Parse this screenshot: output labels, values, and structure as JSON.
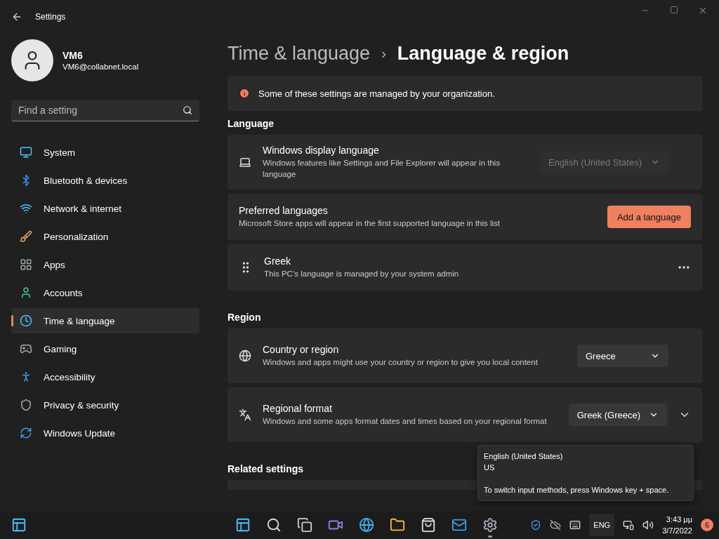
{
  "window": {
    "title": "Settings"
  },
  "user": {
    "name": "VM6",
    "email": "VM6@collabnet.local"
  },
  "search": {
    "placeholder": "Find a setting"
  },
  "nav": [
    {
      "label": "System",
      "selected": false
    },
    {
      "label": "Bluetooth & devices",
      "selected": false
    },
    {
      "label": "Network & internet",
      "selected": false
    },
    {
      "label": "Personalization",
      "selected": false
    },
    {
      "label": "Apps",
      "selected": false
    },
    {
      "label": "Accounts",
      "selected": false
    },
    {
      "label": "Time & language",
      "selected": true
    },
    {
      "label": "Gaming",
      "selected": false
    },
    {
      "label": "Accessibility",
      "selected": false
    },
    {
      "label": "Privacy & security",
      "selected": false
    },
    {
      "label": "Windows Update",
      "selected": false
    }
  ],
  "breadcrumb": {
    "parent": "Time & language",
    "separator": "›",
    "current": "Language & region"
  },
  "notice": "Some of these settings are managed by your organization.",
  "sections": [
    {
      "heading": "Language",
      "cards": [
        {
          "kind": "dropdown",
          "title": "Windows display language",
          "description": "Windows features like Settings and File Explorer will appear in this language",
          "value": "English (United States)",
          "disabled": true
        },
        {
          "kind": "button",
          "title": "Preferred languages",
          "description": "Microsoft Store apps will appear in the first supported language in this list",
          "button": "Add a language"
        },
        {
          "kind": "item",
          "title": "Greek",
          "description": "This PC’s language is managed by your system admin"
        }
      ]
    },
    {
      "heading": "Region",
      "cards": [
        {
          "kind": "dropdown",
          "title": "Country or region",
          "description": "Windows and apps might use your country or region to give you local content",
          "value": "Greece",
          "disabled": false
        },
        {
          "kind": "expander",
          "title": "Regional format",
          "description": "Windows and some apps format dates and times based on your regional format",
          "value": "Greek (Greece)",
          "disabled": false
        }
      ]
    },
    {
      "heading": "Related settings",
      "cards": [
        {
          "kind": "stub"
        }
      ]
    }
  ],
  "tooltip": {
    "lines": [
      "English (United States)",
      "US"
    ],
    "hint": "To switch input methods, press Windows key + space."
  },
  "taskbar": {
    "apps": [
      {
        "running": false
      },
      {
        "running": false
      },
      {
        "running": false
      },
      {
        "running": false
      },
      {
        "running": false
      },
      {
        "running": false
      },
      {
        "running": false
      },
      {
        "running": false
      },
      {
        "running": true
      }
    ],
    "language": "ENG",
    "time": "3:43 μμ",
    "date": "3/7/2022",
    "badge": "6"
  }
}
